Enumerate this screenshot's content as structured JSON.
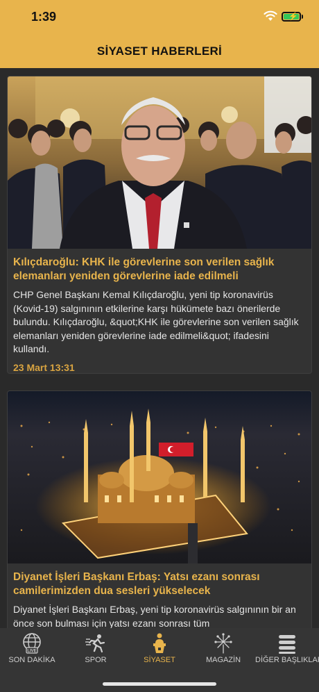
{
  "status": {
    "time": "1:39"
  },
  "nav": {
    "title": "SİYASET HABERLERİ"
  },
  "articles": [
    {
      "headline": "Kılıçdaroğlu: KHK ile görevlerine son verilen sağlık elemanları yeniden görevlerine iade edilmeli",
      "summary": "CHP Genel Başkanı Kemal Kılıçdaroğlu, yeni tip koronavirüs (Kovid-19) salgınının etkilerine karşı hükümete bazı önerilerde bulundu. Kılıçdaroğlu, &quot;KHK ile görevlerine son verilen sağlık elemanları yeniden görevlerine iade edilmeli&quot; ifadesini kullandı.",
      "date": "23 Mart 13:31",
      "image": "politician-photo"
    },
    {
      "headline": "Diyanet İşleri Başkanı Erbaş: Yatsı ezanı sonrası camilerimizden dua sesleri yükselecek",
      "summary": "Diyanet İşleri Başkanı Erbaş, yeni tip koronavirüs salgınının bir an önce son bulması için yatsı ezanı sonrası tüm",
      "image": "mosque-night-photo"
    }
  ],
  "tabs": [
    {
      "label": "SON DAKİKA",
      "icon": "globe-live-icon",
      "active": false
    },
    {
      "label": "SPOR",
      "icon": "runner-icon",
      "active": false
    },
    {
      "label": "SİYASET",
      "icon": "podium-speaker-icon",
      "active": true
    },
    {
      "label": "MAGAZİN",
      "icon": "fireworks-icon",
      "active": false
    },
    {
      "label": "DİĞER BAŞLIKLAR",
      "icon": "list-icon",
      "active": false
    }
  ],
  "colors": {
    "accent": "#e8b44c",
    "background": "#2a2a2a",
    "card": "#333333",
    "tabbar": "#353535"
  }
}
